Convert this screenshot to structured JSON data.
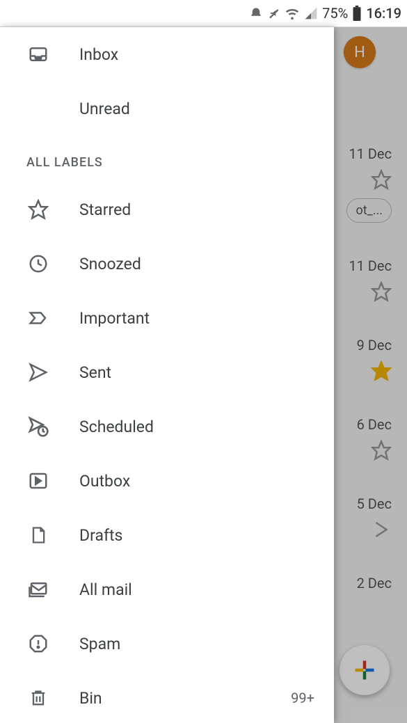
{
  "status_bar": {
    "battery_pct": "75%",
    "time": "16:19"
  },
  "drawer": {
    "inbox": "Inbox",
    "unread": "Unread",
    "section_label": "ALL LABELS",
    "starred": "Starred",
    "snoozed": "Snoozed",
    "important": "Important",
    "sent": "Sent",
    "scheduled": "Scheduled",
    "outbox": "Outbox",
    "drafts": "Drafts",
    "allmail": "All mail",
    "spam": "Spam",
    "bin": "Bin",
    "bin_count": "99+"
  },
  "background": {
    "avatar_letter": "H",
    "chip": "ot_...",
    "dates": [
      "11 Dec",
      "11 Dec",
      "9 Dec",
      "6 Dec",
      "5 Dec",
      "2 Dec"
    ]
  }
}
